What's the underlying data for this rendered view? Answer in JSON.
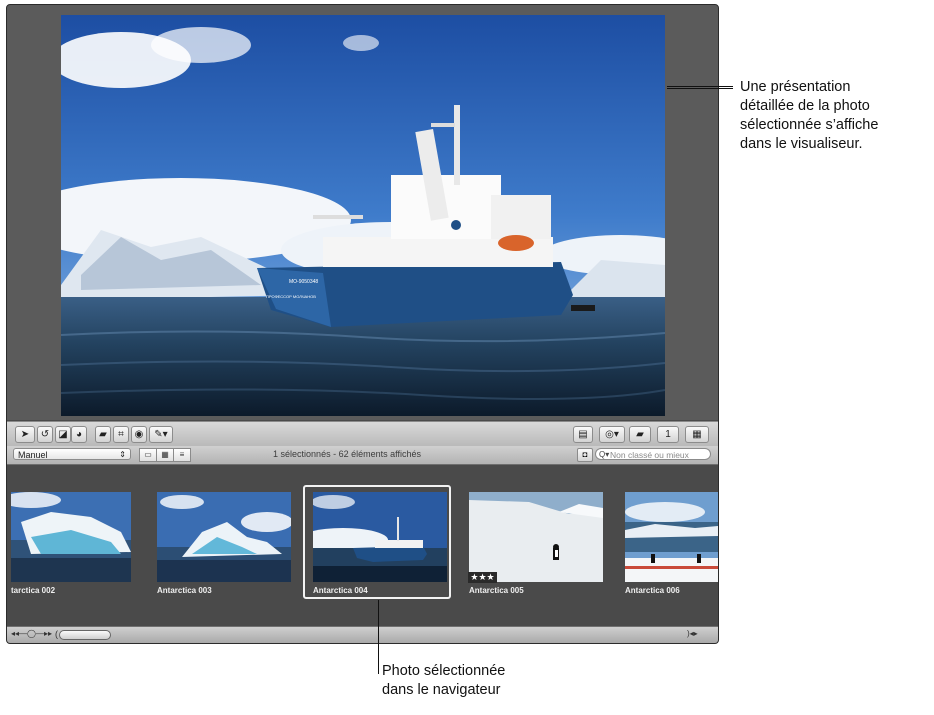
{
  "viewer": {
    "description_icon": "photo-viewer"
  },
  "toolbar": {
    "left_tools": [
      "pointer-icon",
      "rotate-icon",
      "straighten-icon",
      "lift-icon",
      "stamp-icon",
      "crop-icon",
      "red-eye-icon",
      "brush-icon"
    ],
    "right_tools": [
      "adjust-icon",
      "share-icon",
      "flag-icon",
      "single-view-icon",
      "grid-view-icon"
    ]
  },
  "sortbar": {
    "sort_value": "Manuel",
    "status_text": "1 sélectionnés - 62 éléments affichés",
    "filter_placeholder": "Non classé ou mieux"
  },
  "thumbnails": [
    {
      "label": "tarctica 002",
      "rating": ""
    },
    {
      "label": "Antarctica 003",
      "rating": ""
    },
    {
      "label": "Antarctica 004",
      "rating": "",
      "selected": true
    },
    {
      "label": "Antarctica 005",
      "rating": "★★★"
    },
    {
      "label": "Antarctica 006",
      "rating": ""
    }
  ],
  "callouts": {
    "viewer_note": [
      "Une présentation",
      "détaillée de la photo",
      "sélectionnée s’affiche",
      "dans le visualiseur."
    ],
    "browser_note": [
      "Photo sélectionnée",
      "dans le navigateur"
    ]
  },
  "ship_hull_text": "MO-9050348",
  "ship_name_text": "ПРОФЕССОР МОЛЧАНОВ",
  "colors": {
    "window_bg": "#4a4a4a",
    "toolbar_bg": "#c9c9c9",
    "selection_border": "#f2f2f2"
  }
}
